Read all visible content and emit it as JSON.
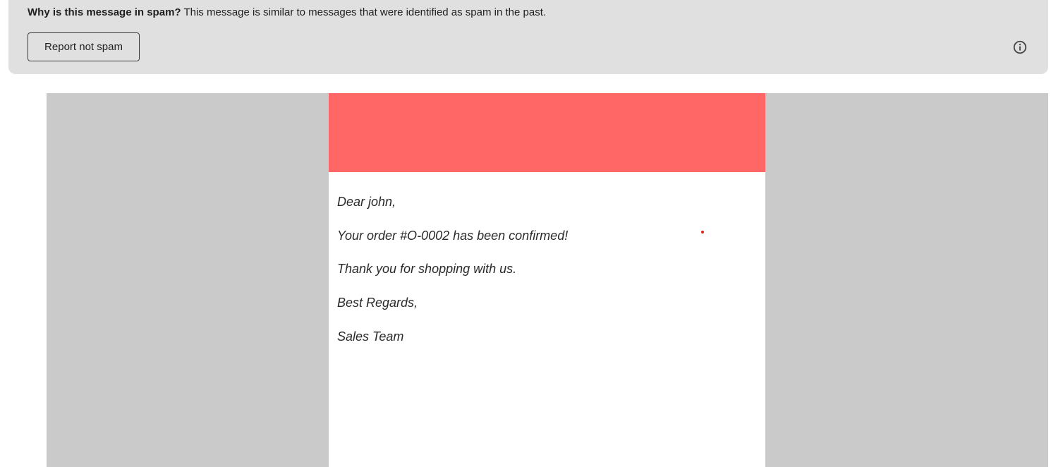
{
  "spam_banner": {
    "question": "Why is this message in spam?",
    "explanation": " This message is similar to messages that were identified as spam in the past.",
    "report_button_label": "Report not spam",
    "info_icon": "info-icon"
  },
  "email": {
    "header_color": "#ff6666",
    "background_color": "#cacaca",
    "greeting": "Dear john,",
    "order_line": "Your order #O-0002 has been confirmed!",
    "thanks_line": "Thank you for shopping with us.",
    "closing": "Best Regards,",
    "signature": "Sales Team"
  }
}
